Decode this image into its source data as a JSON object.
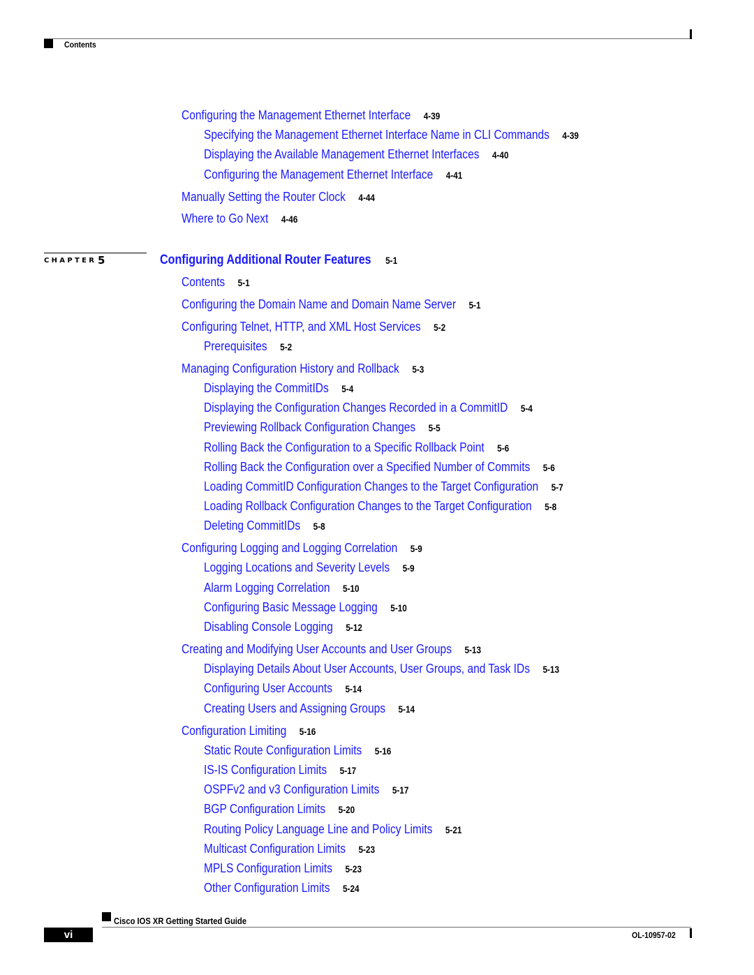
{
  "header": {
    "section_label": "Contents"
  },
  "toc_before": [
    {
      "level": 1,
      "title": "Configuring the Management Ethernet Interface",
      "page": "4-39"
    },
    {
      "level": 2,
      "title": "Specifying the Management Ethernet Interface Name in CLI Commands",
      "page": "4-39"
    },
    {
      "level": 2,
      "title": "Displaying the Available Management Ethernet Interfaces",
      "page": "4-40"
    },
    {
      "level": 2,
      "title": "Configuring the Management Ethernet Interface",
      "page": "4-41"
    },
    {
      "level": 1,
      "title": "Manually Setting the Router Clock",
      "page": "4-44"
    },
    {
      "level": 1,
      "title": "Where to Go Next",
      "page": "4-46"
    }
  ],
  "chapter": {
    "label": "CHAPTER",
    "number": "5",
    "title": "Configuring Additional Router Features",
    "page": "5-1"
  },
  "toc_chapter": [
    {
      "level": 1,
      "title": "Contents",
      "page": "5-1"
    },
    {
      "level": 1,
      "title": "Configuring the Domain Name and Domain Name Server",
      "page": "5-1"
    },
    {
      "level": 1,
      "title": "Configuring Telnet, HTTP, and XML Host Services",
      "page": "5-2"
    },
    {
      "level": 2,
      "title": "Prerequisites",
      "page": "5-2"
    },
    {
      "level": 1,
      "title": "Managing Configuration History and Rollback",
      "page": "5-3"
    },
    {
      "level": 2,
      "title": "Displaying the CommitIDs",
      "page": "5-4"
    },
    {
      "level": 2,
      "title": "Displaying the Configuration Changes Recorded in a CommitID",
      "page": "5-4"
    },
    {
      "level": 2,
      "title": "Previewing Rollback Configuration Changes",
      "page": "5-5"
    },
    {
      "level": 2,
      "title": "Rolling Back the Configuration to a Specific Rollback Point",
      "page": "5-6"
    },
    {
      "level": 2,
      "title": "Rolling Back the Configuration over a Specified Number of Commits",
      "page": "5-6"
    },
    {
      "level": 2,
      "title": "Loading CommitID Configuration Changes to the Target Configuration",
      "page": "5-7"
    },
    {
      "level": 2,
      "title": "Loading Rollback Configuration Changes to the Target Configuration",
      "page": "5-8"
    },
    {
      "level": 2,
      "title": "Deleting CommitIDs",
      "page": "5-8"
    },
    {
      "level": 1,
      "title": "Configuring Logging and Logging Correlation",
      "page": "5-9"
    },
    {
      "level": 2,
      "title": "Logging Locations and Severity Levels",
      "page": "5-9"
    },
    {
      "level": 2,
      "title": "Alarm Logging Correlation",
      "page": "5-10"
    },
    {
      "level": 2,
      "title": "Configuring Basic Message Logging",
      "page": "5-10"
    },
    {
      "level": 2,
      "title": "Disabling Console Logging",
      "page": "5-12"
    },
    {
      "level": 1,
      "title": "Creating and Modifying User Accounts and User Groups",
      "page": "5-13"
    },
    {
      "level": 2,
      "title": "Displaying Details About User Accounts, User Groups, and Task IDs",
      "page": "5-13"
    },
    {
      "level": 2,
      "title": "Configuring User Accounts",
      "page": "5-14"
    },
    {
      "level": 2,
      "title": "Creating Users and Assigning Groups",
      "page": "5-14"
    },
    {
      "level": 1,
      "title": "Configuration Limiting",
      "page": "5-16"
    },
    {
      "level": 2,
      "title": "Static Route Configuration Limits",
      "page": "5-16"
    },
    {
      "level": 2,
      "title": "IS-IS Configuration Limits",
      "page": "5-17"
    },
    {
      "level": 2,
      "title": "OSPFv2 and v3 Configuration Limits",
      "page": "5-17"
    },
    {
      "level": 2,
      "title": "BGP Configuration Limits",
      "page": "5-20"
    },
    {
      "level": 2,
      "title": "Routing Policy Language Line and Policy Limits",
      "page": "5-21"
    },
    {
      "level": 2,
      "title": "Multicast Configuration Limits",
      "page": "5-23"
    },
    {
      "level": 2,
      "title": "MPLS Configuration Limits",
      "page": "5-23"
    },
    {
      "level": 2,
      "title": "Other Configuration Limits",
      "page": "5-24"
    }
  ],
  "footer": {
    "guide_title": "Cisco IOS XR Getting Started Guide",
    "page_number": "vi",
    "doc_number": "OL-10957-02"
  },
  "colors": {
    "link": "#1a1aff",
    "text": "#000000"
  }
}
